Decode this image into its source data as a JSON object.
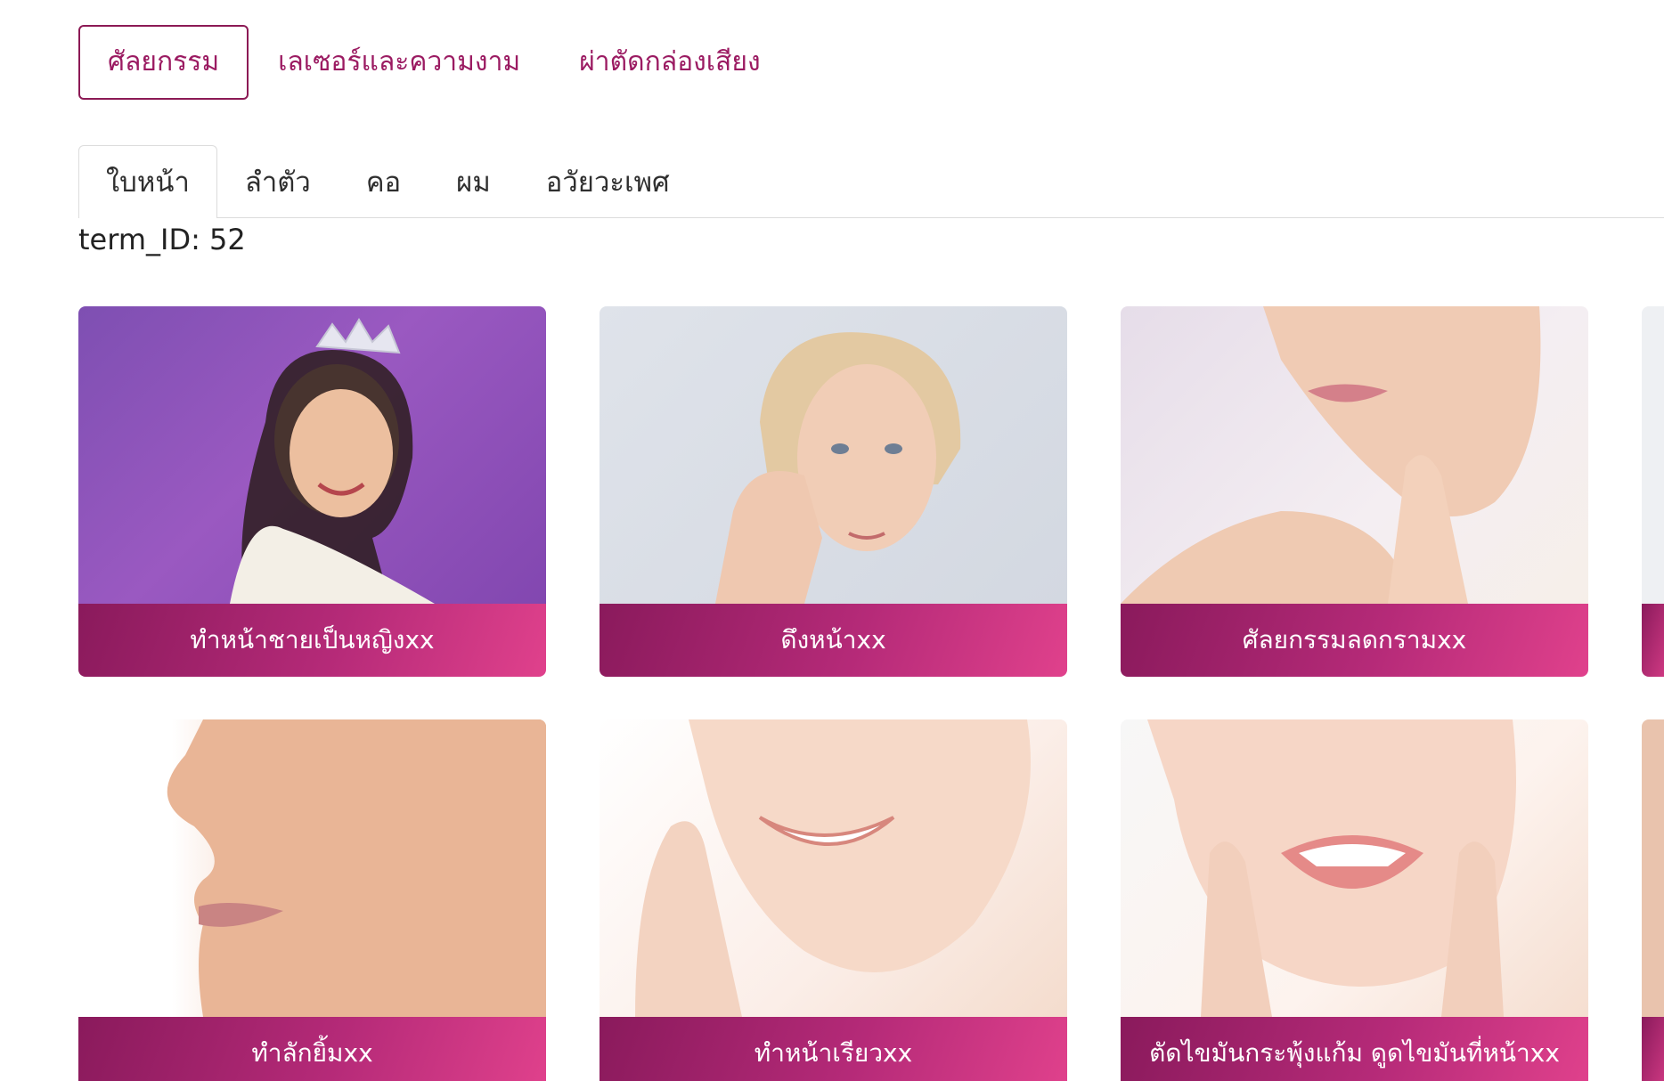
{
  "categories": [
    {
      "label": "ศัลยกรรม",
      "active": true
    },
    {
      "label": "เลเซอร์และความงาม",
      "active": false
    },
    {
      "label": "ผ่าตัดกล่องเสียง",
      "active": false
    }
  ],
  "subtabs": [
    {
      "label": "ใบหน้า",
      "active": true
    },
    {
      "label": "ลำตัว",
      "active": false
    },
    {
      "label": "คอ",
      "active": false
    },
    {
      "label": "ผม",
      "active": false
    },
    {
      "label": "อวัยวะเพศ",
      "active": false
    }
  ],
  "term_id_text": "term_ID: 52",
  "cards": [
    {
      "label": "ทำหน้าชายเป็นหญิงxx",
      "image": "woman-with-tiara-photo"
    },
    {
      "label": "ดึงหน้าxx",
      "image": "mature-woman-touching-face-photo"
    },
    {
      "label": "ศัลยกรรมลดกรามxx",
      "image": "jawline-closeup-photo"
    },
    {
      "label": "ทำลักยิ้มxx",
      "image": "cheek-profile-closeup-photo"
    },
    {
      "label": "ทำหน้าเรียวxx",
      "image": "smiling-face-hand-photo"
    },
    {
      "label": "ตัดไขมันกระพุ้งแก้ม ดูดไขมันที่หน้าxx",
      "image": "smiling-woman-hands-chin-photo"
    }
  ],
  "colors": {
    "accent": "#9b1b62",
    "label_gradient_start": "#8a1a5c",
    "label_gradient_end": "#e0418c"
  }
}
